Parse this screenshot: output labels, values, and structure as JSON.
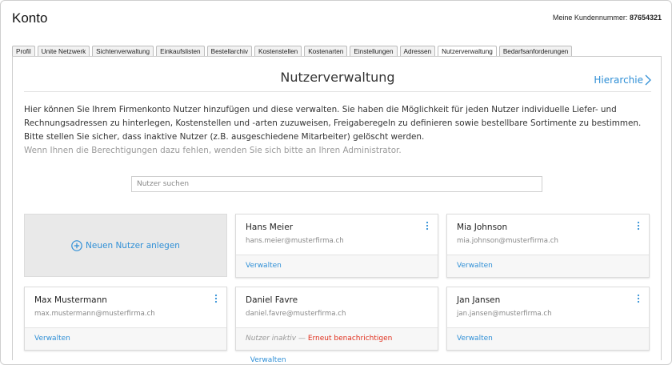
{
  "header": {
    "title": "Konto",
    "customer_label": "Meine Kundennummer:",
    "customer_number": "87654321"
  },
  "tabs": [
    {
      "label": "Profil",
      "active": false
    },
    {
      "label": "Unite Netzwerk",
      "active": false
    },
    {
      "label": "Sichtenverwaltung",
      "active": false
    },
    {
      "label": "Einkaufslisten",
      "active": false
    },
    {
      "label": "Bestellarchiv",
      "active": false
    },
    {
      "label": "Kostenstellen",
      "active": false
    },
    {
      "label": "Kostenarten",
      "active": false
    },
    {
      "label": "Einstellungen",
      "active": false
    },
    {
      "label": "Adressen",
      "active": false
    },
    {
      "label": "Nutzerverwaltung",
      "active": true
    },
    {
      "label": "Bedarfsanforderungen",
      "active": false
    }
  ],
  "main": {
    "heading": "Nutzerverwaltung",
    "hierarchy_link": "Hierarchie",
    "intro": "Hier können Sie Ihrem Firmenkonto Nutzer hinzufügen und diese verwalten. Sie haben die Möglichkeit für jeden Nutzer individuelle Liefer- und Rechnungsadressen zu hinterlegen, Kostenstellen und -arten zuzuweisen, Freigaberegeln zu definieren sowie bestellbare Sortimente zu bestimmen. Bitte stellen Sie sicher, dass inaktive Nutzer (z.B. ausgeschiedene Mitarbeiter) gelöscht werden.",
    "intro_muted": "Wenn Ihnen die Berechtigungen dazu fehlen, wenden Sie sich bitte an Ihren Administrator.",
    "search_placeholder": "Nutzer suchen",
    "new_user_label": "Neuen Nutzer anlegen"
  },
  "users": [
    {
      "name": "Hans Meier",
      "email": "hans.meier@musterfirma.ch",
      "manage": "Verwalten"
    },
    {
      "name": "Mia Johnson",
      "email": "mia.johnson@musterfirma.ch",
      "manage": "Verwalten"
    },
    {
      "name": "Max Mustermann",
      "email": "max.mustermann@musterfirma.ch",
      "manage": "Verwalten"
    },
    {
      "name": "Daniel Favre",
      "email": "daniel.favre@musterfirma.ch",
      "manage": "Verwalten",
      "inactive_label": "Nutzer inaktiv",
      "dash": " — ",
      "notify_label": "Erneut benachrichtigen"
    },
    {
      "name": "Jan Jansen",
      "email": "jan.jansen@musterfirma.ch",
      "manage": "Verwalten"
    }
  ],
  "colors": {
    "link": "#2f8fd6",
    "warning": "#e0301e",
    "tile": "#e9e9e9"
  },
  "icons": {
    "new_user": "plus-circle-icon",
    "menu": "kebab-menu-icon",
    "hierarchy": "chevron-right-icon"
  }
}
